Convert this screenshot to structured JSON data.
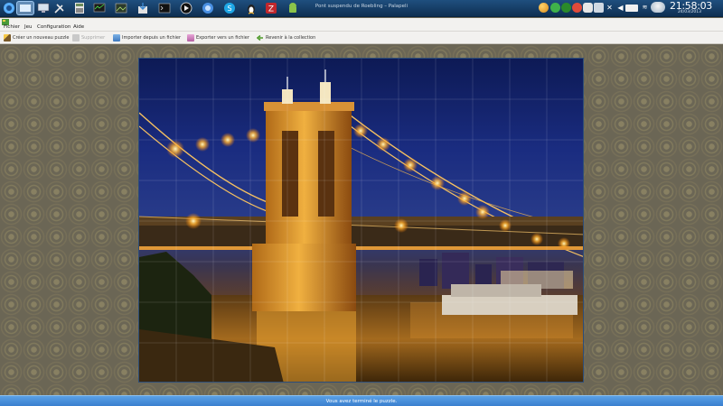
{
  "window": {
    "title": "Pont suspendu de Roebling – Palapeli"
  },
  "taskbar": {
    "launchers": [
      "kde-menu-icon",
      "desktop-pager-icon",
      "computer-icon",
      "settings-tools-icon",
      "calculator-icon",
      "system-monitor-icon",
      "graphics-viewer-icon",
      "package-installer-icon",
      "terminal-icon",
      "media-player-icon",
      "web-browser-icon",
      "skype-icon",
      "linux-penguin-icon",
      "filezilla-icon",
      "android-icon"
    ],
    "clock_time": "21:58:03",
    "clock_date": "24/03/2013"
  },
  "menubar": {
    "items": [
      "Fichier",
      "Jeu",
      "Configuration",
      "Aide"
    ]
  },
  "toolbar": {
    "buttons": [
      {
        "label": "Créer un nouveau puzzle",
        "icon": "wand-icon",
        "enabled": true
      },
      {
        "label": "Supprimer",
        "icon": "delete-icon",
        "enabled": false
      },
      {
        "label": "Importer depuis un fichier",
        "icon": "import-icon",
        "enabled": true
      },
      {
        "label": "Exporter vers un fichier",
        "icon": "export-icon",
        "enabled": true
      },
      {
        "label": "Revenir à la collection",
        "icon": "back-arrow-icon",
        "enabled": true
      }
    ]
  },
  "status": {
    "message": "Vous avez terminé le puzzle."
  },
  "colors": {
    "taskbar": "#12375f",
    "menubar": "#f2f1ef",
    "workspace": "#6b6655",
    "statusbar": "#3a7fcf"
  }
}
